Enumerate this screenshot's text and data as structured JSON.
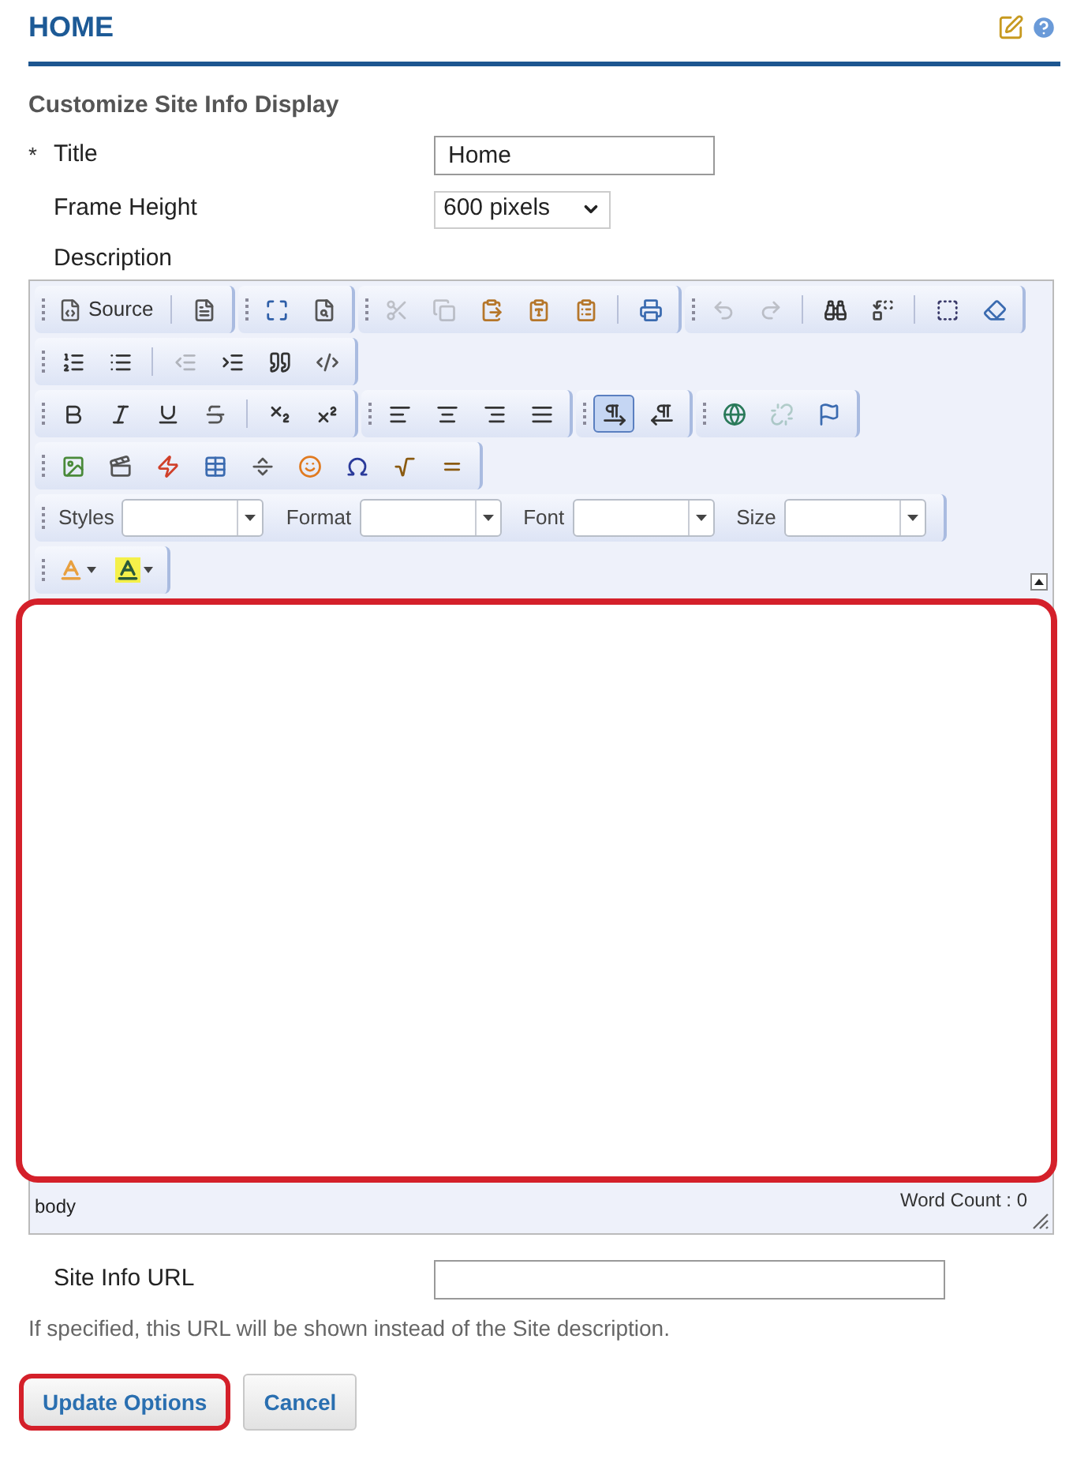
{
  "header": {
    "title": "HOME"
  },
  "section_title": "Customize Site Info Display",
  "fields": [
    {
      "marker": "*",
      "label": "Title",
      "kind": "text",
      "value": "Home"
    },
    {
      "label": "Frame Height",
      "kind": "select",
      "value": "600 pixels"
    }
  ],
  "description_label": "Description",
  "editor": {
    "toolbar_rows": [
      [
        [
          {
            "kind": "source",
            "label": "Source"
          },
          {
            "kind": "separator"
          },
          {
            "kind": "icon",
            "disabled": false
          }
        ],
        [
          {
            "kind": "icon",
            "disabled": false
          },
          {
            "kind": "icon",
            "disabled": false
          }
        ],
        [
          {
            "kind": "icon",
            "disabled": true
          },
          {
            "kind": "icon",
            "disabled": true
          },
          {
            "kind": "icon",
            "disabled": false
          },
          {
            "kind": "icon",
            "disabled": false
          },
          {
            "kind": "icon",
            "disabled": false
          },
          {
            "kind": "separator"
          },
          {
            "kind": "icon",
            "disabled": false
          }
        ],
        [
          {
            "kind": "icon",
            "disabled": true
          },
          {
            "kind": "icon",
            "disabled": true
          },
          {
            "kind": "separator"
          },
          {
            "kind": "icon",
            "disabled": false
          },
          {
            "kind": "icon",
            "disabled": false
          },
          {
            "kind": "separator"
          },
          {
            "kind": "icon",
            "disabled": false
          },
          {
            "kind": "icon",
            "disabled": false
          }
        ]
      ],
      [
        [
          {
            "kind": "icon",
            "disabled": false
          },
          {
            "kind": "icon",
            "disabled": false
          },
          {
            "kind": "separator"
          },
          {
            "kind": "icon",
            "disabled": true
          },
          {
            "kind": "icon",
            "disabled": false
          },
          {
            "kind": "icon",
            "disabled": false
          },
          {
            "kind": "icon",
            "disabled": false
          }
        ]
      ],
      [
        [
          {
            "kind": "icon",
            "disabled": false
          },
          {
            "kind": "icon",
            "disabled": false
          },
          {
            "kind": "icon",
            "disabled": false
          },
          {
            "kind": "icon",
            "disabled": false
          },
          {
            "kind": "separator"
          },
          {
            "kind": "icon",
            "disabled": false
          },
          {
            "kind": "icon",
            "disabled": false
          }
        ],
        [
          {
            "kind": "icon",
            "disabled": false
          },
          {
            "kind": "icon",
            "disabled": false
          },
          {
            "kind": "icon",
            "disabled": false
          },
          {
            "kind": "icon",
            "disabled": false
          }
        ],
        [
          {
            "kind": "toggle",
            "selected": true
          },
          {
            "kind": "toggle",
            "selected": false
          }
        ],
        [
          {
            "kind": "icon",
            "disabled": false
          },
          {
            "kind": "icon",
            "disabled": true
          },
          {
            "kind": "icon",
            "disabled": false
          }
        ]
      ],
      [
        [
          {
            "kind": "icon",
            "disabled": false
          },
          {
            "kind": "icon",
            "disabled": false
          },
          {
            "kind": "icon",
            "disabled": false
          },
          {
            "kind": "icon",
            "disabled": false
          },
          {
            "kind": "icon",
            "disabled": false
          },
          {
            "kind": "icon",
            "disabled": false
          },
          {
            "kind": "icon",
            "disabled": false
          },
          {
            "kind": "icon",
            "disabled": false
          },
          {
            "kind": "icon",
            "disabled": false
          }
        ]
      ],
      [
        [
          {
            "kind": "combo",
            "label": "Styles"
          },
          {
            "kind": "combo",
            "label": "Format"
          },
          {
            "kind": "combo",
            "label": "Font"
          },
          {
            "kind": "combo",
            "label": "Size"
          }
        ]
      ],
      [
        [
          {
            "kind": "color"
          },
          {
            "kind": "color"
          }
        ]
      ]
    ],
    "highlighted": true,
    "path": "body",
    "word_count": "Word Count : 0"
  },
  "url_field": {
    "label": "Site Info URL",
    "hint": "If specified, this URL will be shown instead of the Site description."
  },
  "buttons": [
    {
      "label": "Update Options",
      "highlighted": true
    },
    {
      "label": "Cancel",
      "highlighted": false
    }
  ]
}
